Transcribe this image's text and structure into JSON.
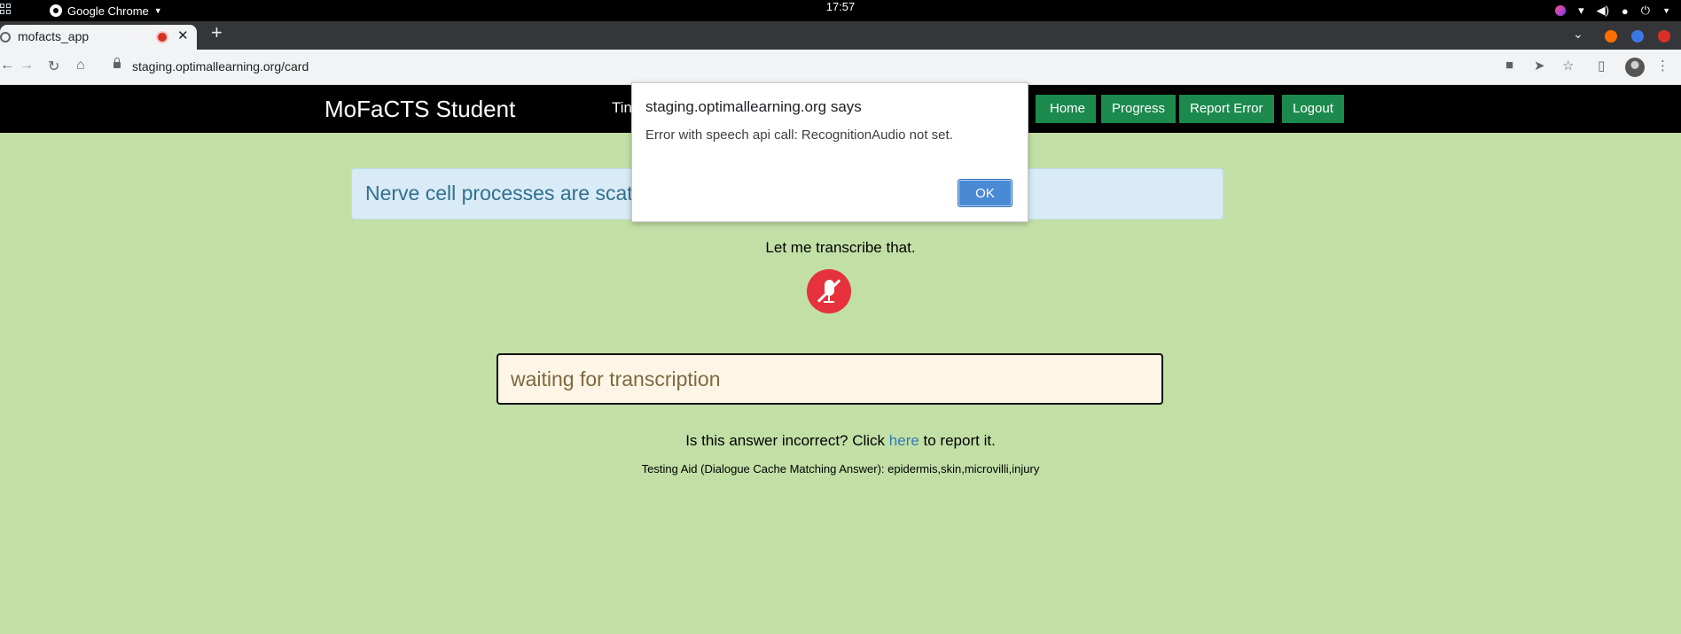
{
  "os": {
    "app_name": "Google Chrome",
    "clock": "17:57"
  },
  "browser": {
    "tab_title": "mofacts_app",
    "tab_close": "✕",
    "new_tab": "+",
    "url": "staging.optimallearning.org/card",
    "colors": {
      "dot1": "#ff6d00",
      "dot2": "#3b78e7",
      "dot3": "#d93025"
    }
  },
  "navbar": {
    "brand": "MoFaCTS Student",
    "left_text": "Tin",
    "buttons": [
      "Home",
      "Progress",
      "Report Error",
      "Logout"
    ]
  },
  "card": {
    "question": "Nerve cell processes are scat",
    "prompt": "Let me transcribe that.",
    "answer_value": "waiting for transcription",
    "report_prefix": "Is this answer incorrect? Click ",
    "report_link": "here",
    "report_suffix": " to report it.",
    "testing_aid": "Testing Aid (Dialogue Cache Matching Answer): epidermis,skin,microvilli,injury"
  },
  "dialog": {
    "title": "staging.optimallearning.org says",
    "message": "Error with speech api call: RecognitionAudio not set.",
    "ok_label": "OK"
  }
}
